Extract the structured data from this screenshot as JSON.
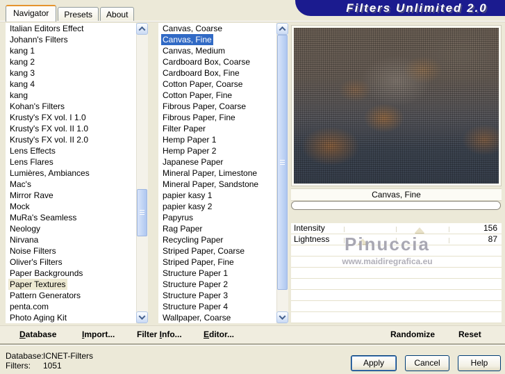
{
  "window": {
    "title": "Filters Unlimited 2.0"
  },
  "tabs": [
    {
      "label": "Navigator"
    },
    {
      "label": "Presets"
    },
    {
      "label": "About"
    }
  ],
  "navigator_list": {
    "selected": "Paper Textures",
    "items": [
      "Italian Editors Effect",
      "Johann's Filters",
      "kang 1",
      "kang 2",
      "kang 3",
      "kang 4",
      "kang",
      "Kohan's Filters",
      "Krusty's FX vol. I 1.0",
      "Krusty's FX vol. II 1.0",
      "Krusty's FX vol. II 2.0",
      "Lens Effects",
      "Lens Flares",
      "Lumières, Ambiances",
      "Mac's",
      "Mirror Rave",
      "Mock",
      "MuRa's Seamless",
      "Neology",
      "Nirvana",
      "Noise Filters",
      "Oliver's Filters",
      "Paper Backgrounds",
      "Paper Textures",
      "Pattern Generators",
      "penta.com",
      "Photo Aging Kit"
    ]
  },
  "filter_list": {
    "selected": "Canvas, Fine",
    "items": [
      "Canvas, Coarse",
      "Canvas, Fine",
      "Canvas, Medium",
      "Cardboard Box, Coarse",
      "Cardboard Box, Fine",
      "Cotton Paper, Coarse",
      "Cotton Paper, Fine",
      "Fibrous Paper, Coarse",
      "Fibrous Paper, Fine",
      "Filter Paper",
      "Hemp Paper 1",
      "Hemp Paper 2",
      "Japanese Paper",
      "Mineral Paper, Limestone",
      "Mineral Paper, Sandstone",
      "papier kasy 1",
      "papier kasy 2",
      "Papyrus",
      "Rag Paper",
      "Recycling Paper",
      "Striped Paper, Coarse",
      "Striped Paper, Fine",
      "Structure Paper 1",
      "Structure Paper 2",
      "Structure Paper 3",
      "Structure Paper 4",
      "Wallpaper, Coarse"
    ]
  },
  "right_panel": {
    "preview_caption": "Canvas, Fine",
    "progress_value": 0,
    "sliders": [
      {
        "label": "Intensity",
        "value": 156,
        "max": 255
      },
      {
        "label": "Lightness",
        "value": 87,
        "max": 255
      }
    ],
    "watermark": {
      "line1": "Pinuccia",
      "line2": "www.maidiregrafica.eu"
    },
    "randomize_label": "Randomize",
    "reset_label": "Reset"
  },
  "toolbar": {
    "items": [
      {
        "label": "Database",
        "underline": 0
      },
      {
        "label": "Import...",
        "underline": 0
      },
      {
        "label": "Filter Info...",
        "underline": 7
      },
      {
        "label": "Editor...",
        "underline": 0
      }
    ]
  },
  "status": {
    "database_label": "Database:",
    "database_value": "ICNET-Filters",
    "filters_label": "Filters:",
    "filters_value": "1051"
  },
  "dialog_buttons": {
    "apply": "Apply",
    "cancel": "Cancel",
    "help": "Help"
  },
  "colors": {
    "background": "#ECE9D8",
    "banner": "#1B1B8F",
    "selection_blue": "#316AC5",
    "inactive_selection": "#EDE9D2",
    "tab_accent": "#E5942D"
  }
}
